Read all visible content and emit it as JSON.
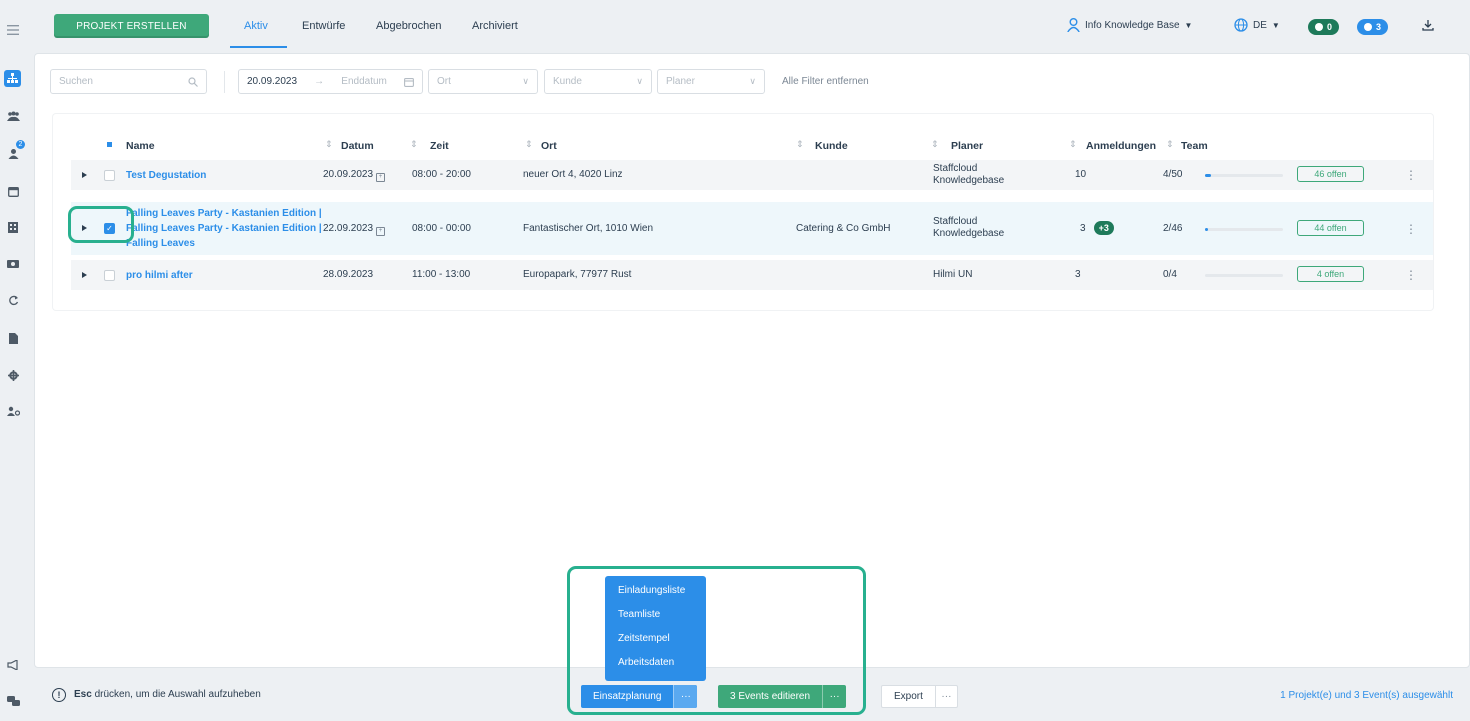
{
  "sidebar": {
    "icons": [
      "menu-icon",
      "projects-icon",
      "team-icon",
      "user-add-icon",
      "calendar-icon",
      "building-icon",
      "money-icon",
      "sync-icon",
      "document-icon",
      "gear-icon",
      "user-group-icon",
      "announce-icon",
      "chat-icon"
    ],
    "notification_badge": "2"
  },
  "topbar": {
    "create_button": "PROJEKT ERSTELLEN",
    "tabs": [
      "Aktiv",
      "Entwürfe",
      "Abgebrochen",
      "Archiviert"
    ],
    "active_tab": "Aktiv",
    "user": "Info Knowledge Base",
    "language": "DE",
    "badge_green": "0",
    "badge_blue": "3",
    "accent": "#2c8ee8",
    "green": "#3ea87a"
  },
  "filters": {
    "search_placeholder": "Suchen",
    "start_date": "20.09.2023",
    "end_date_placeholder": "Enddatum",
    "location_placeholder": "Ort",
    "customer_placeholder": "Kunde",
    "planner_placeholder": "Planer",
    "clear_all": "Alle Filter entfernen"
  },
  "table": {
    "columns": [
      "Name",
      "Datum",
      "Zeit",
      "Ort",
      "Kunde",
      "Planer",
      "Anmeldungen",
      "Team"
    ],
    "rows": [
      {
        "name": "Test Degustation",
        "date": "20.09.2023",
        "time": "08:00 - 20:00",
        "location": "neuer Ort 4, 4020 Linz",
        "customer": "",
        "planner": "Staffcloud Knowledgebase",
        "registrations": "10",
        "registrations_extra": "",
        "team": "4/50",
        "team_fill": 0.08,
        "open": "46 offen"
      },
      {
        "name": "Falling Leaves Party - Kastanien Edition | Falling Leaves Party - Kastanien Edition | Falling Leaves",
        "date": "22.09.2023",
        "time": "08:00 - 00:00",
        "location": "Fantastischer Ort, 1010 Wien",
        "customer": "Catering & Co GmbH",
        "planner": "Staffcloud Knowledgebase",
        "registrations": "3",
        "registrations_extra": "+3",
        "team": "2/46",
        "team_fill": 0.04,
        "open": "44 offen"
      },
      {
        "name": "pro hilmi after",
        "date": "28.09.2023",
        "time": "11:00 - 13:00",
        "location": "Europapark, 77977 Rust",
        "customer": "",
        "planner": "Hilmi UN",
        "registrations": "3",
        "registrations_extra": "",
        "team": "0/4",
        "team_fill": 0,
        "open": "4 offen"
      }
    ]
  },
  "dropdown": {
    "items": [
      "Einladungsliste",
      "Teamliste",
      "Zeitstempel",
      "Arbeitsdaten"
    ]
  },
  "bottombar": {
    "esc_key": "Esc",
    "esc_hint": "drücken, um die Auswahl aufzuheben",
    "einsatzplanung": "Einsatzplanung",
    "edit_events": "3 Events editieren",
    "export": "Export",
    "more": "···",
    "selection": "1 Projekt(e) und 3 Event(s) ausgewählt"
  }
}
